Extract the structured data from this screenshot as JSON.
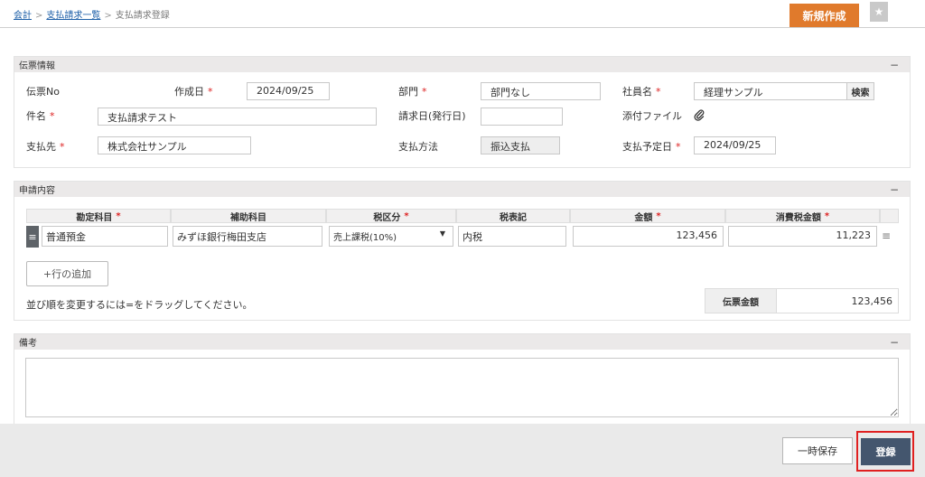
{
  "breadcrumb": {
    "items": [
      "会計",
      "支払請求一覧"
    ],
    "current": "支払請求登録",
    "separator": ">"
  },
  "header": {
    "new_button": "新規作成",
    "star_icon": "★"
  },
  "voucher": {
    "title": "伝票情報",
    "collapse": "−",
    "fields": {
      "voucher_no": {
        "label": "伝票No",
        "value": ""
      },
      "created_date": {
        "label": "作成日",
        "value": "2024/09/25"
      },
      "department": {
        "label": "部門",
        "value": "部門なし"
      },
      "employee": {
        "label": "社員名",
        "value": "経理サンプル",
        "search": "検索"
      },
      "subject": {
        "label": "件名",
        "value": "支払請求テスト"
      },
      "invoice_date": {
        "label": "請求日(発行日)",
        "value": ""
      },
      "attachment": {
        "label": "添付ファイル",
        "icon": "paperclip-icon"
      },
      "payee": {
        "label": "支払先",
        "value": "株式会社サンプル"
      },
      "payment_method": {
        "label": "支払方法",
        "value": "振込支払"
      },
      "payment_due": {
        "label": "支払予定日",
        "value": "2024/09/25"
      }
    },
    "required_mark": "*"
  },
  "application": {
    "title": "申請内容",
    "collapse": "−",
    "columns": [
      "勘定科目",
      "補助科目",
      "税区分",
      "税表記",
      "金額",
      "消費税金額"
    ],
    "required_columns": [
      true,
      false,
      true,
      false,
      true,
      true
    ],
    "rows": [
      {
        "account": "普通預金",
        "sub_account": "みずほ銀行梅田支店",
        "tax_class": "売上課税(10%)",
        "tax_notation": "内税",
        "amount": "123,456",
        "tax_amount": "11,223"
      }
    ],
    "add_row": "+行の追加",
    "drag_note": "並び順を変更するには=をドラッグしてください。",
    "total_label": "伝票金額",
    "total_value": "123,456"
  },
  "remarks": {
    "title": "備考",
    "collapse": "−",
    "value": ""
  },
  "footer": {
    "temp_save": "一時保存",
    "register": "登録"
  }
}
